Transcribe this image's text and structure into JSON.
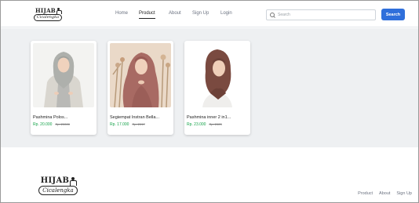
{
  "brand": {
    "logo_top": "HIJAB",
    "logo_bottom": "Cicalengka"
  },
  "nav": {
    "links": [
      "Home",
      "Product",
      "About",
      "Sign Up",
      "Login"
    ],
    "active": "Product"
  },
  "search": {
    "placeholder": "Search",
    "button_label": "Search"
  },
  "products": [
    {
      "title": "Pashmina Polos...",
      "price": "Rp. 20.000",
      "old_price": "Rp. 20000",
      "image": "woman-grey-hijab-blazer"
    },
    {
      "title": "Segiempat Instran Bella...",
      "price": "Rp. 17.000",
      "old_price": "Rp. 2017",
      "image": "woman-dusty-rose-hijab"
    },
    {
      "title": "Pashmina inner 2 in1...",
      "price": "Rp. 23.000",
      "old_price": "Rp. 2023",
      "image": "woman-brown-hijab"
    }
  ],
  "footer": {
    "logo_top": "HIJAB",
    "logo_bottom": "Cicalengka",
    "links": [
      "Product",
      "About",
      "Sign Up"
    ]
  },
  "colors": {
    "accent": "#2f6fdb",
    "price": "#16a34a",
    "content_bg": "#eef0f2"
  }
}
